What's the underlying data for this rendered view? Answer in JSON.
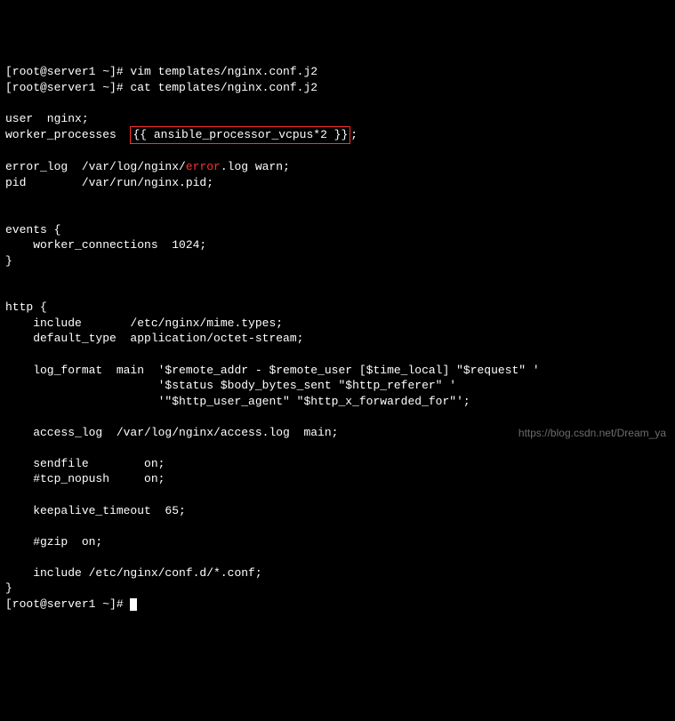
{
  "prompt_line0_partial": "[root@server1 ~]# vim templates/nginx.conf.j2",
  "prompt": "[root@server1 ~]# ",
  "command": "cat templates/nginx.conf.j2",
  "lines": {
    "l3": "",
    "l4a": "user  nginx;",
    "l5a": "worker_processes  ",
    "l5b": "{{ ansible_processor_vcpus*2 }}",
    "l5c": ";",
    "l6": "",
    "l7a": "error_log  /var/log/nginx/",
    "l7b": "error",
    "l7c": ".log warn;",
    "l8": "pid        /var/run/nginx.pid;",
    "l9": "",
    "l10": "",
    "l11": "events {",
    "l12": "    worker_connections  1024;",
    "l13": "}",
    "l14": "",
    "l15": "",
    "l16": "http {",
    "l17": "    include       /etc/nginx/mime.types;",
    "l18": "    default_type  application/octet-stream;",
    "l19": "",
    "l20": "    log_format  main  '$remote_addr - $remote_user [$time_local] \"$request\" '",
    "l21": "                      '$status $body_bytes_sent \"$http_referer\" '",
    "l22": "                      '\"$http_user_agent\" \"$http_x_forwarded_for\"';",
    "l23": "",
    "l24": "    access_log  /var/log/nginx/access.log  main;",
    "l25": "",
    "l26": "    sendfile        on;",
    "l27": "    #tcp_nopush     on;",
    "l28": "",
    "l29": "    keepalive_timeout  65;",
    "l30": "",
    "l31": "    #gzip  on;",
    "l32": "",
    "l33": "    include /etc/nginx/conf.d/*.conf;",
    "l34": "}",
    "prompt2": "[root@server1 ~]# "
  },
  "watermark": "https://blog.csdn.net/Dream_ya"
}
